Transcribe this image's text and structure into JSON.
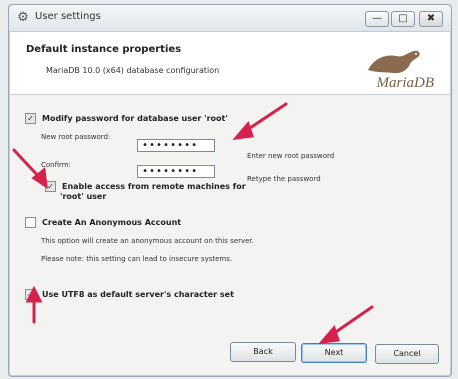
{
  "window": {
    "title": "User settings",
    "minimize": "—",
    "maximize": "□",
    "close": "✖"
  },
  "header": {
    "title": "Default instance properties",
    "subtitle": "MariaDB 10.0 (x64) database configuration",
    "logo_text": "MariaDB"
  },
  "form": {
    "modify_password_label": "Modify password for database user 'root'",
    "new_root_password_label": "New root password:",
    "new_root_password_value": "••••••••",
    "new_root_password_hint": "Enter new root password",
    "confirm_label": "Confirm:",
    "confirm_value": "••••••••",
    "confirm_hint": "Retype the password",
    "remote_access_label_line1": "Enable access from remote machines for",
    "remote_access_label_line2": "'root' user",
    "anonymous_label": "Create An Anonymous Account",
    "anonymous_note1": "This option will create an anonymous account on this server.",
    "anonymous_note2": "Please note: this setting can lead to insecure systems.",
    "utf8_label": "Use UTF8 as default server's character set"
  },
  "buttons": {
    "back": "Back",
    "next": "Next",
    "cancel": "Cancel"
  },
  "colors": {
    "annotation_arrow": "#d6204d",
    "logo": "#7a6048"
  }
}
